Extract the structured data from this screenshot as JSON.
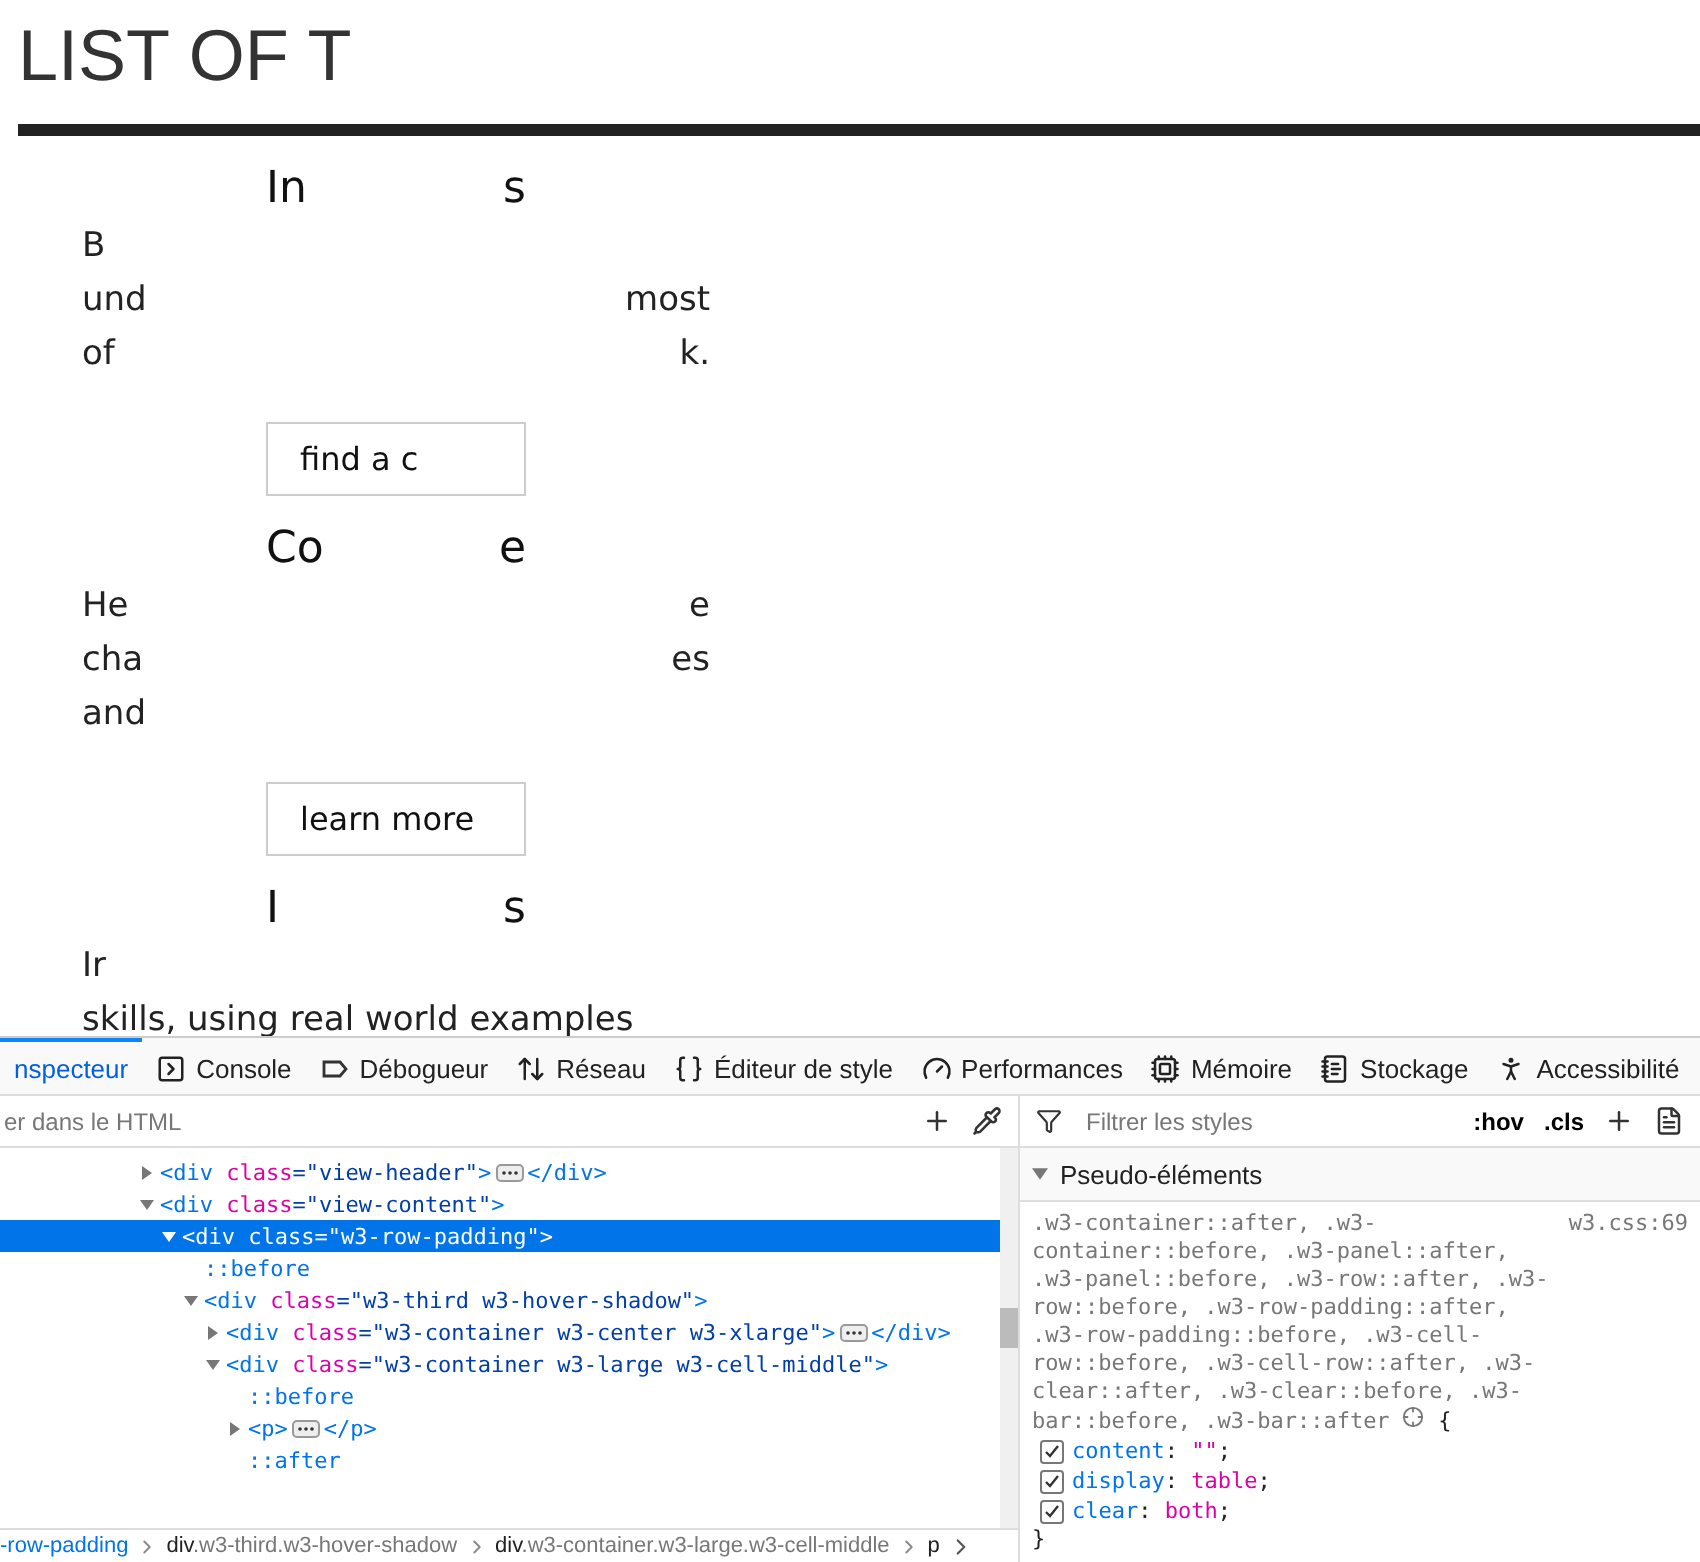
{
  "page": {
    "title": "LIST OF T",
    "cards": [
      {
        "heading": {
          "left": "In",
          "right": "s"
        },
        "lines": [
          {
            "left": "B"
          },
          {
            "left": "und",
            "right": "most"
          },
          {
            "left": "of",
            "right": "k."
          }
        ],
        "button": "find a c"
      },
      {
        "heading": {
          "left": "Co",
          "right": "e"
        },
        "lines": [
          {
            "left": "He",
            "right": "e"
          },
          {
            "left": "cha",
            "right": "es"
          },
          {
            "left": "and"
          }
        ],
        "button": "learn more"
      },
      {
        "heading": {
          "left": "I",
          "right": "s"
        },
        "lines": [
          {
            "left": "Ir"
          },
          {
            "left": "skills, using real world examples"
          }
        ]
      }
    ]
  },
  "devtools": {
    "tabs": [
      {
        "label": "nspecteur",
        "selected": true
      },
      {
        "label": "Console",
        "selected": false
      },
      {
        "label": "Débogueur",
        "selected": false
      },
      {
        "label": "Réseau",
        "selected": false
      },
      {
        "label": "Éditeur de style",
        "selected": false
      },
      {
        "label": "Performances",
        "selected": false
      },
      {
        "label": "Mémoire",
        "selected": false
      },
      {
        "label": "Stockage",
        "selected": false
      },
      {
        "label": "Accessibilité",
        "selected": false
      }
    ],
    "html_search": {
      "placeholder": "er dans le HTML"
    },
    "tree": [
      {
        "kind": "element",
        "open": "<div",
        "attr": "class",
        "value": "=\"view-header\"",
        "end": ">",
        "close": "</div>",
        "expanded": false,
        "selected": false
      },
      {
        "kind": "element",
        "open": "<div",
        "attr": "class",
        "value": "=\"view-content\"",
        "end": ">",
        "expanded": true,
        "selected": false,
        "children": [
          {
            "kind": "element",
            "open": "<div",
            "attr": "class",
            "value": "=\"w3-row-padding\"",
            "end": ">",
            "expanded": true,
            "selected": true,
            "children": [
              {
                "kind": "pseudo",
                "text": "::before",
                "selected": false
              },
              {
                "kind": "element",
                "open": "<div",
                "attr": "class",
                "value": "=\"w3-third w3-hover-shadow\"",
                "end": ">",
                "expanded": true,
                "selected": false,
                "children": [
                  {
                    "kind": "element",
                    "open": "<div",
                    "attr": "class",
                    "value": "=\"w3-container w3-center w3-xlarge\"",
                    "end": ">",
                    "close": "</div>",
                    "expanded": false,
                    "selected": false
                  },
                  {
                    "kind": "element",
                    "open": "<div",
                    "attr": "class",
                    "value": "=\"w3-container w3-large w3-cell-middle\"",
                    "end": ">",
                    "expanded": true,
                    "selected": false,
                    "children": [
                      {
                        "kind": "pseudo",
                        "text": "::before",
                        "selected": false
                      },
                      {
                        "kind": "element",
                        "open": "<p",
                        "end": ">",
                        "close": "</p>",
                        "expanded": false,
                        "selected": false
                      },
                      {
                        "kind": "pseudo",
                        "text": "::after",
                        "selected": false
                      }
                    ]
                  }
                ]
              }
            ]
          }
        ]
      }
    ],
    "breadcrumbs": [
      {
        "classes": "-row-padding",
        "selected": true
      },
      {
        "tag": "div",
        "classes": ".w3-third.w3-hover-shadow",
        "selected": false
      },
      {
        "tag": "div",
        "classes": ".w3-container.w3-large.w3-cell-middle",
        "selected": false
      },
      {
        "tag": "p",
        "selected": false
      }
    ],
    "styles": {
      "filter": {
        "placeholder": "Filtrer les styles"
      },
      "toggles": [
        ":hov",
        ".cls"
      ],
      "section": {
        "title": "Pseudo-éléments",
        "expanded": true
      },
      "rule": {
        "selector": ".w3-container::after, .w3-container::before, .w3-panel::after, .w3-panel::before, .w3-row::after, .w3-row::before, .w3-row-padding::after, .w3-row-padding::before, .w3-cell-row::before, .w3-cell-row::after, .w3-clear::after, .w3-clear::before, .w3-bar::before, .w3-bar::after",
        "source": "w3.css:69",
        "open": "{",
        "close": "}",
        "declarations": [
          {
            "property": "content",
            "sep": ":",
            "value": "\"\"",
            "end": ";",
            "checked": true
          },
          {
            "property": "display",
            "sep": ":",
            "value": "table",
            "end": ";",
            "checked": true
          },
          {
            "property": "clear",
            "sep": ":",
            "value": "both",
            "end": ";",
            "checked": true
          }
        ]
      }
    }
  }
}
